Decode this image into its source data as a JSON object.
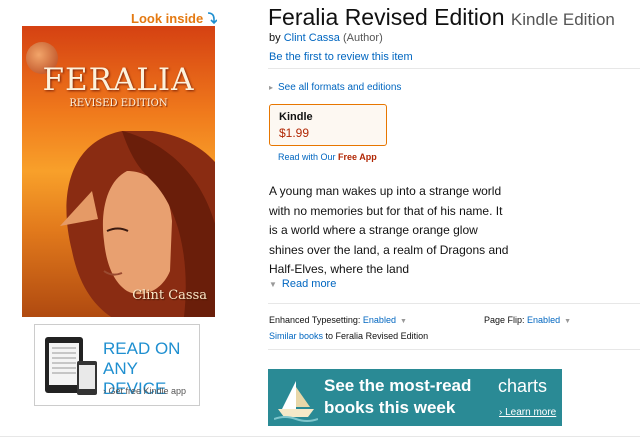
{
  "look_inside": "Look inside",
  "cover": {
    "title": "FERALIA",
    "subtitle": "REVISED EDITION",
    "author": "Clint Cassa"
  },
  "kindle_app": {
    "line1": "READ ON",
    "line2": "ANY DEVICE",
    "cta": "Get free Kindle app"
  },
  "product": {
    "title": "Feralia Revised Edition",
    "format": "Kindle Edition",
    "by": "by",
    "author": "Clint Cassa",
    "author_role": "(Author)",
    "review_link": "Be the first to review this item",
    "formats_link": "See all formats and editions"
  },
  "buybox": {
    "label": "Kindle",
    "price": "$1.99",
    "read_with": "Read with Our",
    "free_app": "Free App"
  },
  "description": {
    "text": "A young man wakes up into a strange world with no memories but for that of his name. It is a world where a strange orange glow shines over the land, a realm of Dragons and Half-Elves, where the land",
    "read_more": "Read more"
  },
  "details": {
    "enhanced_label": "Enhanced Typesetting:",
    "enhanced_value": "Enabled",
    "pageflip_label": "Page Flip:",
    "pageflip_value": "Enabled",
    "similar_link": "Similar books",
    "similar_rest": "to Feralia Revised Edition"
  },
  "banner": {
    "line1": "See the most-read",
    "line2": "books this week",
    "charts": "charts",
    "learn_more": "Learn more"
  },
  "colors": {
    "link": "#0066c0",
    "price": "#b12704",
    "look_inside": "#e47911",
    "banner": "#2a8a95"
  }
}
